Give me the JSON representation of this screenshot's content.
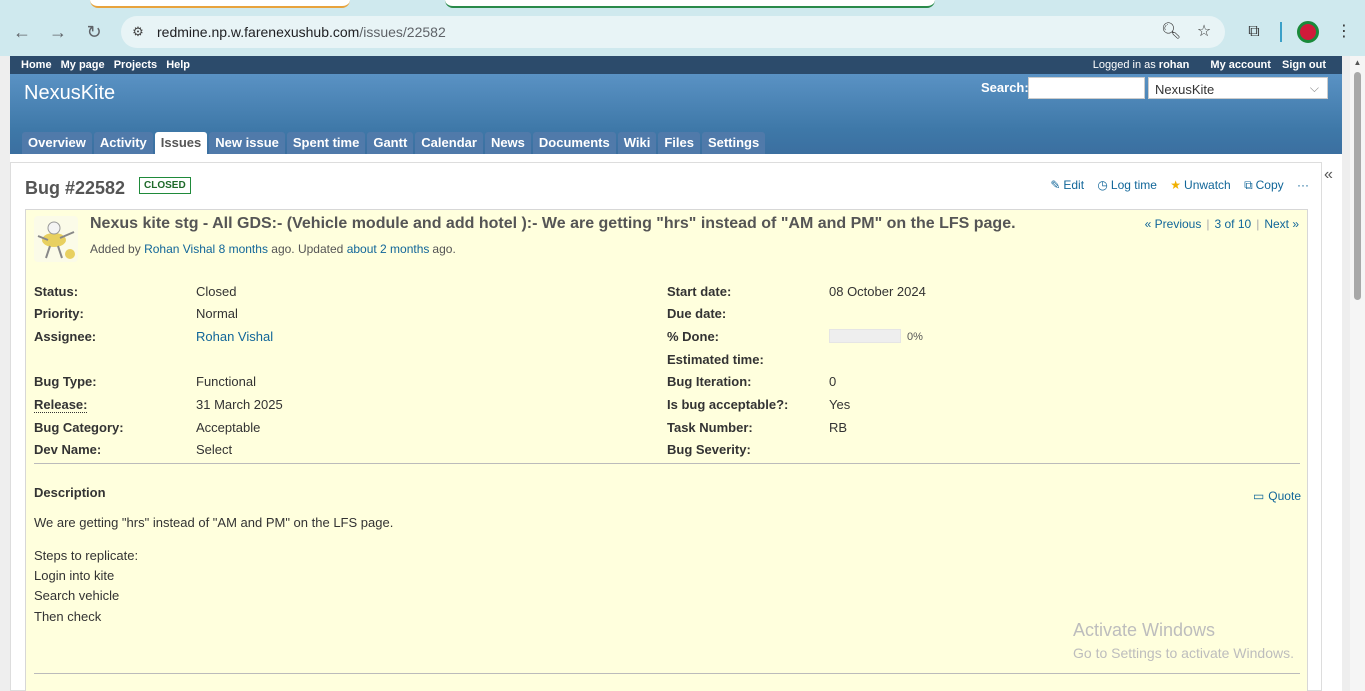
{
  "browser": {
    "url_host": "redmine.np.w.farenexushub.com",
    "url_path": "/issues/22582"
  },
  "top_menu": {
    "left": [
      "Home",
      "My page",
      "Projects",
      "Help"
    ],
    "logged_in_prefix": "Logged in as",
    "user": "rohan",
    "my_account": "My account",
    "sign_out": "Sign out"
  },
  "header": {
    "site_title": "NexusKite",
    "search_label": "Search:",
    "search_value": "",
    "project_selected": "NexusKite"
  },
  "main_menu": [
    "Overview",
    "Activity",
    "Issues",
    "New issue",
    "Spent time",
    "Gantt",
    "Calendar",
    "News",
    "Documents",
    "Wiki",
    "Files",
    "Settings"
  ],
  "issue": {
    "heading": "Bug #22582",
    "status_badge": "CLOSED",
    "actions": {
      "edit": "Edit",
      "log_time": "Log time",
      "unwatch": "Unwatch",
      "copy": "Copy",
      "more": "···"
    },
    "subject": "Nexus kite stg - All GDS:- (Vehicle module and add hotel ):- We are getting \"hrs\" instead of \"AM and PM\" on the LFS page.",
    "author_prefix": "Added by",
    "author": "Rohan Vishal",
    "added_ago": "8 months",
    "ago1": "ago. Updated",
    "updated_ago": "about 2 months",
    "ago2": "ago.",
    "nav": {
      "previous": "« Previous",
      "position": "3 of 10",
      "next": "Next »"
    },
    "attributes_left": [
      {
        "label": "Status:",
        "value": "Closed"
      },
      {
        "label": "Priority:",
        "value": "Normal"
      },
      {
        "label": "Assignee:",
        "value": "Rohan Vishal"
      },
      {
        "label": "Bug Type:",
        "value": "Functional"
      },
      {
        "label": "Release:",
        "value": "31 March 2025"
      },
      {
        "label": "Bug Category:",
        "value": "Acceptable"
      },
      {
        "label": "Dev Name:",
        "value": "Select"
      }
    ],
    "attributes_right": [
      {
        "label": "Start date:",
        "value": "08 October 2024"
      },
      {
        "label": "Due date:",
        "value": ""
      },
      {
        "label": "% Done:",
        "value": "0%"
      },
      {
        "label": "Estimated time:",
        "value": ""
      },
      {
        "label": "Bug Iteration:",
        "value": "0"
      },
      {
        "label": "Is bug acceptable?:",
        "value": "Yes"
      },
      {
        "label": "Task Number:",
        "value": "RB"
      },
      {
        "label": "Bug Severity:",
        "value": ""
      }
    ],
    "done_ratio": 0,
    "description_heading": "Description",
    "quote": "Quote",
    "description_lines": [
      "We are getting \"hrs\" instead of \"AM and PM\" on the LFS page.",
      "Steps to replicate:",
      "Login into kite",
      "Search vehicle",
      "Then check"
    ]
  },
  "watermark": {
    "line1": "Activate Windows",
    "line2": "Go to Settings to activate Windows."
  }
}
